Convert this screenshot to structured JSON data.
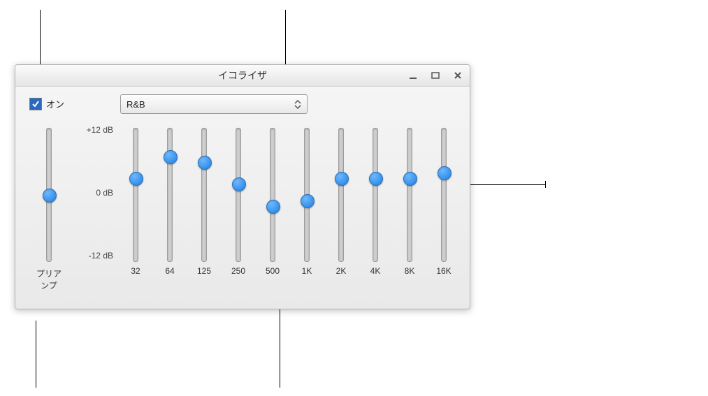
{
  "window": {
    "title": "イコライザ",
    "minimize_icon": "minimize-icon",
    "maximize_icon": "maximize-icon",
    "close_icon": "close-icon"
  },
  "on": {
    "label": "オン",
    "checked": true
  },
  "preset": {
    "selected": "R&B"
  },
  "scale": {
    "max_label": "+12 dB",
    "mid_label": "0 dB",
    "min_label": "-12 dB"
  },
  "preamp": {
    "label": "プリアンプ",
    "value_db": 0
  },
  "bands": [
    {
      "freq_label": "32",
      "value_db": 3
    },
    {
      "freq_label": "64",
      "value_db": 7
    },
    {
      "freq_label": "125",
      "value_db": 6
    },
    {
      "freq_label": "250",
      "value_db": 2
    },
    {
      "freq_label": "500",
      "value_db": -2
    },
    {
      "freq_label": "1K",
      "value_db": -1
    },
    {
      "freq_label": "2K",
      "value_db": 3
    },
    {
      "freq_label": "4K",
      "value_db": 3
    },
    {
      "freq_label": "8K",
      "value_db": 3
    },
    {
      "freq_label": "16K",
      "value_db": 4
    }
  ],
  "chart_data": {
    "type": "bar",
    "title": "イコライザ",
    "ylabel": "dB",
    "ylim": [
      -12,
      12
    ],
    "categories": [
      "32",
      "64",
      "125",
      "250",
      "500",
      "1K",
      "2K",
      "4K",
      "8K",
      "16K"
    ],
    "values": [
      3,
      7,
      6,
      2,
      -2,
      -1,
      3,
      3,
      3,
      4
    ],
    "preamp": 0,
    "preset": "R&B"
  },
  "colors": {
    "thumb": "#1e7fe0",
    "track": "#cfcfcf",
    "window_bg_top": "#f6f6f6",
    "window_bg_bottom": "#e9e9e9"
  }
}
